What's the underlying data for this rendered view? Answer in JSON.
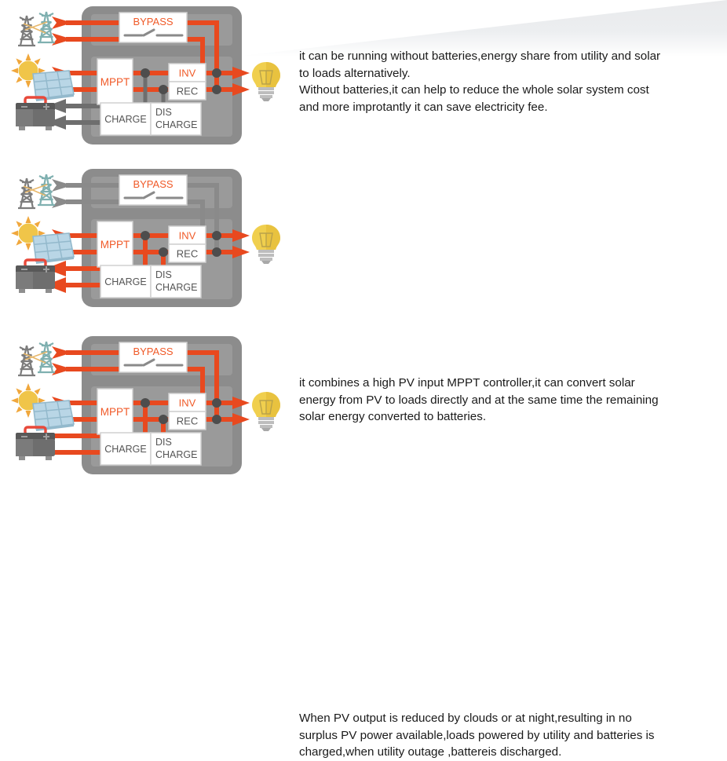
{
  "page": {
    "title": "Hybrid solar inverter operating modes",
    "background": "#ffffff",
    "wedge_color": "#e9eaec"
  },
  "colors": {
    "active_orange": "#e8491f",
    "label_orange": "#f05a28",
    "inactive_gray": "#6e6e6e",
    "case_gray": "#8c8c8c",
    "case_inner_gray": "#9a9a9a",
    "box_white": "#ffffff",
    "box_border": "#bdbdbd",
    "text_dark": "#333333",
    "bulb_yellow": "#f0cf4e",
    "solar_blue": "#a8cade",
    "sun_orange": "#f0a73c",
    "battery_gray": "#6b6b6b",
    "battery_handle_red": "#e8493a",
    "tower_gray": "#7d7d7d",
    "tower_teal": "#7fb0b0"
  },
  "block_labels": {
    "bypass": "BYPASS",
    "mppt": "MPPT",
    "inv": "INV",
    "rec": "REC",
    "charge": "CHARGE",
    "discharge_line1": "DIS",
    "discharge_line2": "CHARGE"
  },
  "icons": {
    "utility": "power-transmission-tower-icon",
    "pv": "solar-panel-sun-icon",
    "battery": "battery-icon",
    "load": "light-bulb-icon",
    "switch": "bypass-switch-icon"
  },
  "panels": [
    {
      "id": "panel-1",
      "mode": "no-battery-utility-and-solar-share",
      "description": "it can be running without batteries,energy share from utility and solar\nto loads alternatively.\nWithout batteries,it can help to reduce the whole solar system cost\nand more improtantly it can save electricity fee.",
      "flows": {
        "utility_input": "active",
        "pv_input": "active",
        "battery_link": "inactive",
        "battery_direction": "to-battery",
        "battery_arrowheads": true,
        "load_output": "active",
        "internal_battery_drops": "inactive"
      }
    },
    {
      "id": "panel-2",
      "mode": "mppt-solar-to-loads-and-battery",
      "description": "it combines a high PV input MPPT controller,it can convert solar\nenergy from PV to loads directly and at the same time the remaining\nsolar energy converted to batteries.",
      "flows": {
        "utility_input": "inactive",
        "pv_input": "active",
        "battery_link": "active",
        "battery_direction": "to-battery",
        "battery_arrowheads": true,
        "load_output": "active",
        "internal_battery_drops": "active"
      }
    },
    {
      "id": "panel-3",
      "mode": "utility-and-battery-support-at-night",
      "description": "When PV output is reduced by clouds or at night,resulting in no\nsurplus PV power available,loads powered by utility and batteries is\ncharged,when utility outage ,battereis discharged.",
      "flows": {
        "utility_input": "active",
        "pv_input": "active",
        "battery_link": "active",
        "battery_direction": "bidirectional",
        "battery_arrowheads": false,
        "load_output": "active",
        "internal_battery_drops": "active"
      }
    }
  ]
}
